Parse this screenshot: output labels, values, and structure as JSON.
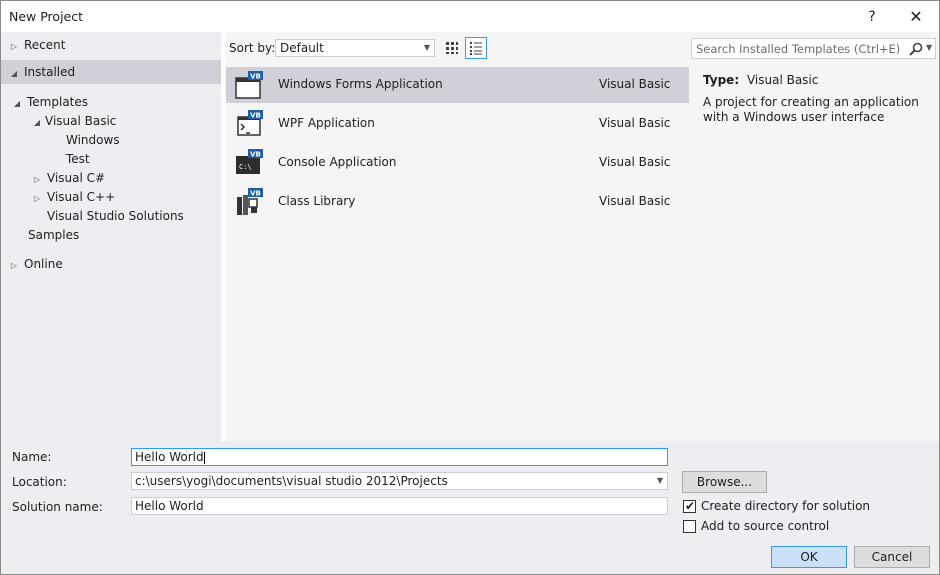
{
  "window": {
    "title": "New Project",
    "help_glyph": "?",
    "close_glyph": "✕"
  },
  "tree": {
    "recent": "Recent",
    "installed": "Installed",
    "templates": "Templates",
    "visual_basic": "Visual Basic",
    "windows": "Windows",
    "test": "Test",
    "visual_csharp": "Visual C#",
    "visual_cpp": "Visual C++",
    "vs_solutions": "Visual Studio Solutions",
    "samples": "Samples",
    "online": "Online"
  },
  "sortbar": {
    "label": "Sort by:",
    "value": "Default"
  },
  "templates": [
    {
      "name": "Windows Forms Application",
      "lang": "Visual Basic",
      "icon": "windows-forms-icon",
      "selected": true
    },
    {
      "name": "WPF Application",
      "lang": "Visual Basic",
      "icon": "wpf-icon",
      "selected": false
    },
    {
      "name": "Console Application",
      "lang": "Visual Basic",
      "icon": "console-icon",
      "selected": false
    },
    {
      "name": "Class Library",
      "lang": "Visual Basic",
      "icon": "class-library-icon",
      "selected": false
    }
  ],
  "details": {
    "search_placeholder": "Search Installed Templates (Ctrl+E)",
    "type_key": "Type:",
    "type_value": "Visual Basic",
    "description": "A project for creating an application with a Windows user interface"
  },
  "form": {
    "name_label": "Name:",
    "name_value": "Hello World",
    "location_label": "Location:",
    "location_value": "c:\\users\\yogi\\documents\\visual studio 2012\\Projects",
    "solution_label": "Solution name:",
    "solution_value": "Hello World",
    "browse_label": "Browse...",
    "create_dir_label": "Create directory for solution",
    "create_dir_checked": true,
    "source_control_label": "Add to source control",
    "source_control_checked": false,
    "ok_label": "OK",
    "cancel_label": "Cancel"
  },
  "colors": {
    "accent": "#3399ff",
    "vb_badge": "#1f5fa8",
    "selection": "#cfd0d8"
  }
}
